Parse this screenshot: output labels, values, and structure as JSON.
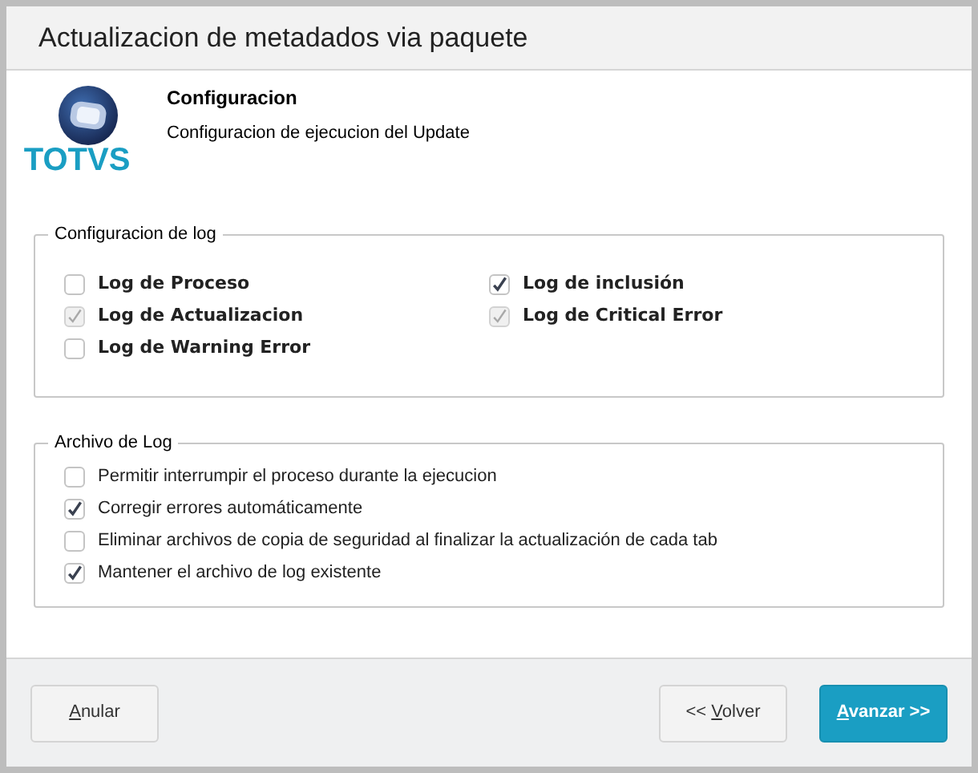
{
  "window": {
    "title": "Actualizacion de metadados via paquete"
  },
  "header": {
    "logo_text": "TOTVS",
    "title": "Configuracion",
    "subtitle": "Configuracion de ejecucion del Update"
  },
  "log_config": {
    "legend": "Configuracion de log",
    "options": [
      {
        "label": "Log de Proceso",
        "checked": false,
        "disabled": false
      },
      {
        "label": "Log de inclusión",
        "checked": true,
        "disabled": false
      },
      {
        "label": "Log de Actualizacion",
        "checked": true,
        "disabled": true
      },
      {
        "label": "Log de Critical Error",
        "checked": true,
        "disabled": true
      },
      {
        "label": "Log de Warning Error",
        "checked": false,
        "disabled": false
      }
    ]
  },
  "log_file": {
    "legend": "Archivo de Log",
    "options": [
      {
        "label": "Permitir interrumpir el proceso durante la ejecucion",
        "checked": false
      },
      {
        "label": "Corregir errores automáticamente",
        "checked": true
      },
      {
        "label": "Eliminar archivos de copia de seguridad al finalizar la actualización de cada tab",
        "checked": false
      },
      {
        "label": "Mantener el archivo de log existente",
        "checked": true
      }
    ]
  },
  "buttons": [
    {
      "access_key": "A",
      "after": "nular",
      "kind": "plain"
    },
    {
      "before": "<< ",
      "access_key": "V",
      "after": "olver",
      "kind": "plain"
    },
    {
      "access_key": "A",
      "after": "vanzar >>",
      "kind": "primary"
    }
  ]
}
